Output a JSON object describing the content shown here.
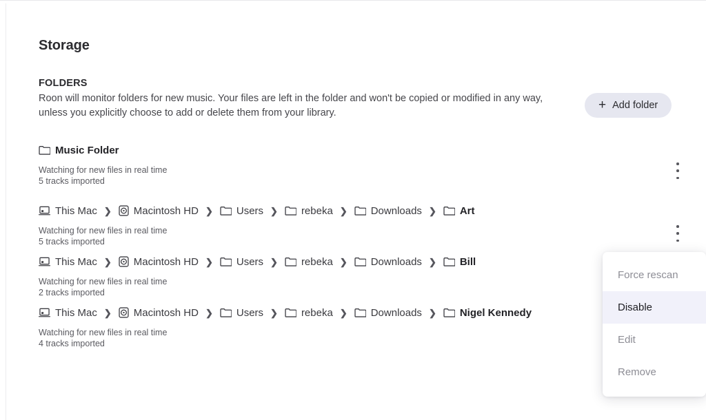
{
  "page": {
    "title": "Storage"
  },
  "section": {
    "heading": "FOLDERS",
    "description": "Roon will monitor folders for new music. Your files are left in the folder and won't be copied or modified in any way, unless you explicitly choose to add or delete them from your library."
  },
  "add_folder_button": {
    "label": "Add folder",
    "plus": "+",
    "background_color": "#e6e7f0"
  },
  "separator": "❯",
  "folders": [
    {
      "crumbs": [
        {
          "icon": "folder-icon",
          "label": "Music Folder",
          "bold": true
        }
      ],
      "watch_status": "Watching for new files in real time",
      "tracks_imported": "5 tracks imported"
    },
    {
      "crumbs": [
        {
          "icon": "mac-icon",
          "label": "This Mac",
          "bold": false
        },
        {
          "icon": "disk-icon",
          "label": "Macintosh HD",
          "bold": false
        },
        {
          "icon": "folder-icon",
          "label": "Users",
          "bold": false
        },
        {
          "icon": "folder-icon",
          "label": "rebeka",
          "bold": false
        },
        {
          "icon": "folder-icon",
          "label": "Downloads",
          "bold": false
        },
        {
          "icon": "folder-icon",
          "label": "Art",
          "bold": true
        }
      ],
      "watch_status": "Watching for new files in real time",
      "tracks_imported": "5 tracks imported"
    },
    {
      "crumbs": [
        {
          "icon": "mac-icon",
          "label": "This Mac",
          "bold": false
        },
        {
          "icon": "disk-icon",
          "label": "Macintosh HD",
          "bold": false
        },
        {
          "icon": "folder-icon",
          "label": "Users",
          "bold": false
        },
        {
          "icon": "folder-icon",
          "label": "rebeka",
          "bold": false
        },
        {
          "icon": "folder-icon",
          "label": "Downloads",
          "bold": false
        },
        {
          "icon": "folder-icon",
          "label": "Bill",
          "bold": true
        }
      ],
      "watch_status": "Watching for new files in real time",
      "tracks_imported": "2 tracks imported"
    },
    {
      "crumbs": [
        {
          "icon": "mac-icon",
          "label": "This Mac",
          "bold": false
        },
        {
          "icon": "disk-icon",
          "label": "Macintosh HD",
          "bold": false
        },
        {
          "icon": "folder-icon",
          "label": "Users",
          "bold": false
        },
        {
          "icon": "folder-icon",
          "label": "rebeka",
          "bold": false
        },
        {
          "icon": "folder-icon",
          "label": "Downloads",
          "bold": false
        },
        {
          "icon": "folder-icon",
          "label": "Nigel Kennedy",
          "bold": true
        }
      ],
      "watch_status": "Watching for new files in real time",
      "tracks_imported": "4 tracks imported"
    }
  ],
  "context_menu": {
    "items": [
      {
        "label": "Force rescan",
        "active": false
      },
      {
        "label": "Disable",
        "active": true
      },
      {
        "label": "Edit",
        "active": false
      },
      {
        "label": "Remove",
        "active": false
      }
    ],
    "highlight_color": "#f1f1fa"
  }
}
